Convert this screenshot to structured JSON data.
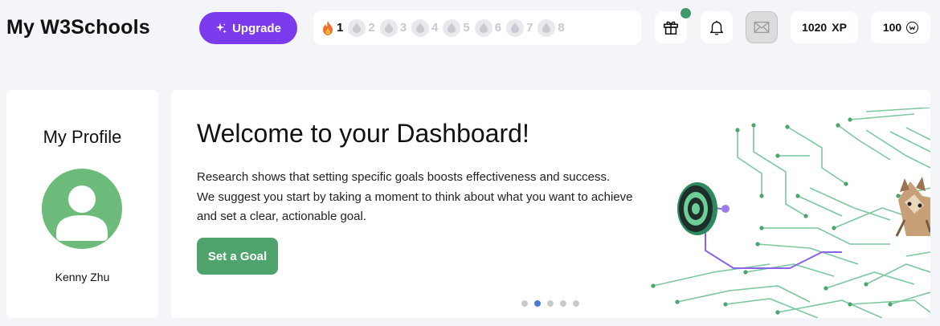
{
  "header": {
    "brand": "My W3Schools",
    "upgrade_label": "Upgrade",
    "streak_days": [
      "1",
      "2",
      "3",
      "4",
      "5",
      "6",
      "7",
      "8"
    ],
    "active_day": "1",
    "xp_value": "1020",
    "xp_unit": "XP",
    "coins_value": "100",
    "icons": {
      "upgrade": "sparkle-icon",
      "gift": "gift-icon",
      "notifications": "bell-icon",
      "messages": "mail-icon",
      "coins": "coin-icon",
      "streak_active": "flame-icon",
      "streak_inactive": "drop-icon"
    }
  },
  "profile": {
    "title": "My Profile",
    "name": "Kenny Zhu"
  },
  "dashboard": {
    "title": "Welcome to your Dashboard!",
    "body_lines": [
      "Research shows that setting specific goals boosts effectiveness and success.",
      "We suggest you start by taking a moment to think about what you want to achieve",
      "and set a clear, actionable goal."
    ],
    "cta_label": "Set a Goal",
    "carousel_total": 5,
    "carousel_active": 2
  },
  "colors": {
    "background": "#f4f5f9",
    "upgrade_purple": "#7c3aed",
    "goal_green": "#4ea46c",
    "avatar_green": "#6cbb7b",
    "notification_dot": "#3f9b6f",
    "carousel_active": "#4a77d4"
  }
}
